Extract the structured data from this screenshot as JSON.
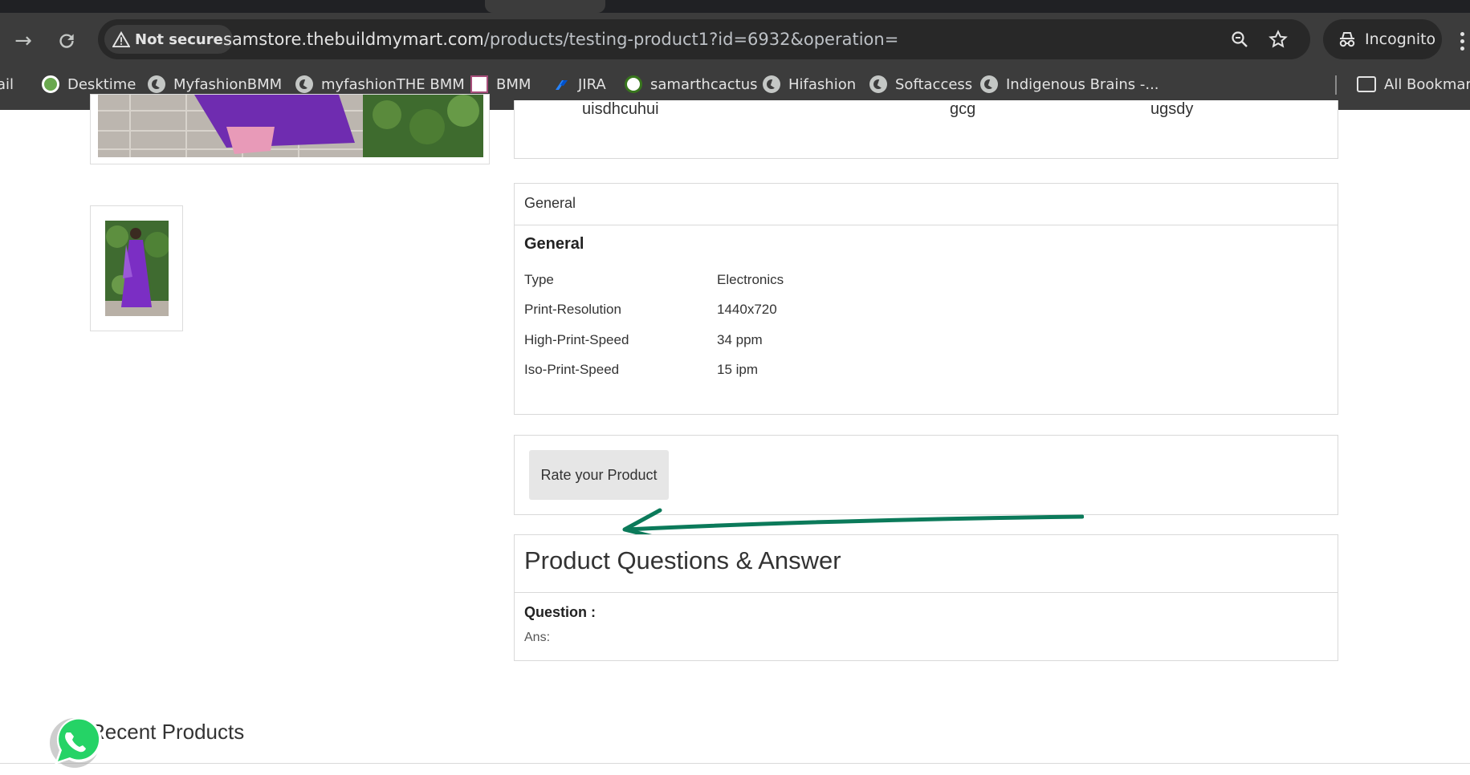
{
  "browser": {
    "security_label": "Not secure",
    "url_host": "samstore.thebuildmymart.com",
    "url_path": "/products/testing-product1?id=6932&operation=",
    "profile_label": "Incognito",
    "bookmarks": [
      {
        "label": "ail",
        "icon": "mail-icon"
      },
      {
        "label": "Desktime",
        "icon": "desktime-icon"
      },
      {
        "label": "MyfashionBMM",
        "icon": "globe-icon"
      },
      {
        "label": "myfashionTHE BMM",
        "icon": "globe-icon"
      },
      {
        "label": "BMM",
        "icon": "bmm-icon"
      },
      {
        "label": "JIRA",
        "icon": "jira-icon"
      },
      {
        "label": "samarthcactus",
        "icon": "samarth-icon"
      },
      {
        "label": "Hifashion",
        "icon": "globe-icon"
      },
      {
        "label": "Softaccess",
        "icon": "globe-icon"
      },
      {
        "label": "Indigenous Brains -...",
        "icon": "globe-icon"
      }
    ],
    "all_bookmarks_label": "All Bookmarks"
  },
  "table_row": {
    "col1": "uisdhcuhui",
    "col2": "gcg",
    "col3": "ugsdy"
  },
  "general": {
    "header": "General",
    "title": "General",
    "specs": [
      {
        "key": "Type",
        "value": "Electronics"
      },
      {
        "key": "Print-Resolution",
        "value": "1440x720"
      },
      {
        "key": "High-Print-Speed",
        "value": "34 ppm"
      },
      {
        "key": "Iso-Print-Speed",
        "value": "15 ipm"
      }
    ]
  },
  "rating": {
    "button_label": "Rate your Product"
  },
  "qa": {
    "title": "Product Questions & Answer",
    "question_label": "Question :",
    "answer_label": "Ans:"
  },
  "recent": {
    "title": "Recent Products"
  },
  "colors": {
    "chrome_bg": "#3c3c3c",
    "annotation_arrow": "#0b7a5a",
    "whatsapp_green": "#25d366"
  }
}
